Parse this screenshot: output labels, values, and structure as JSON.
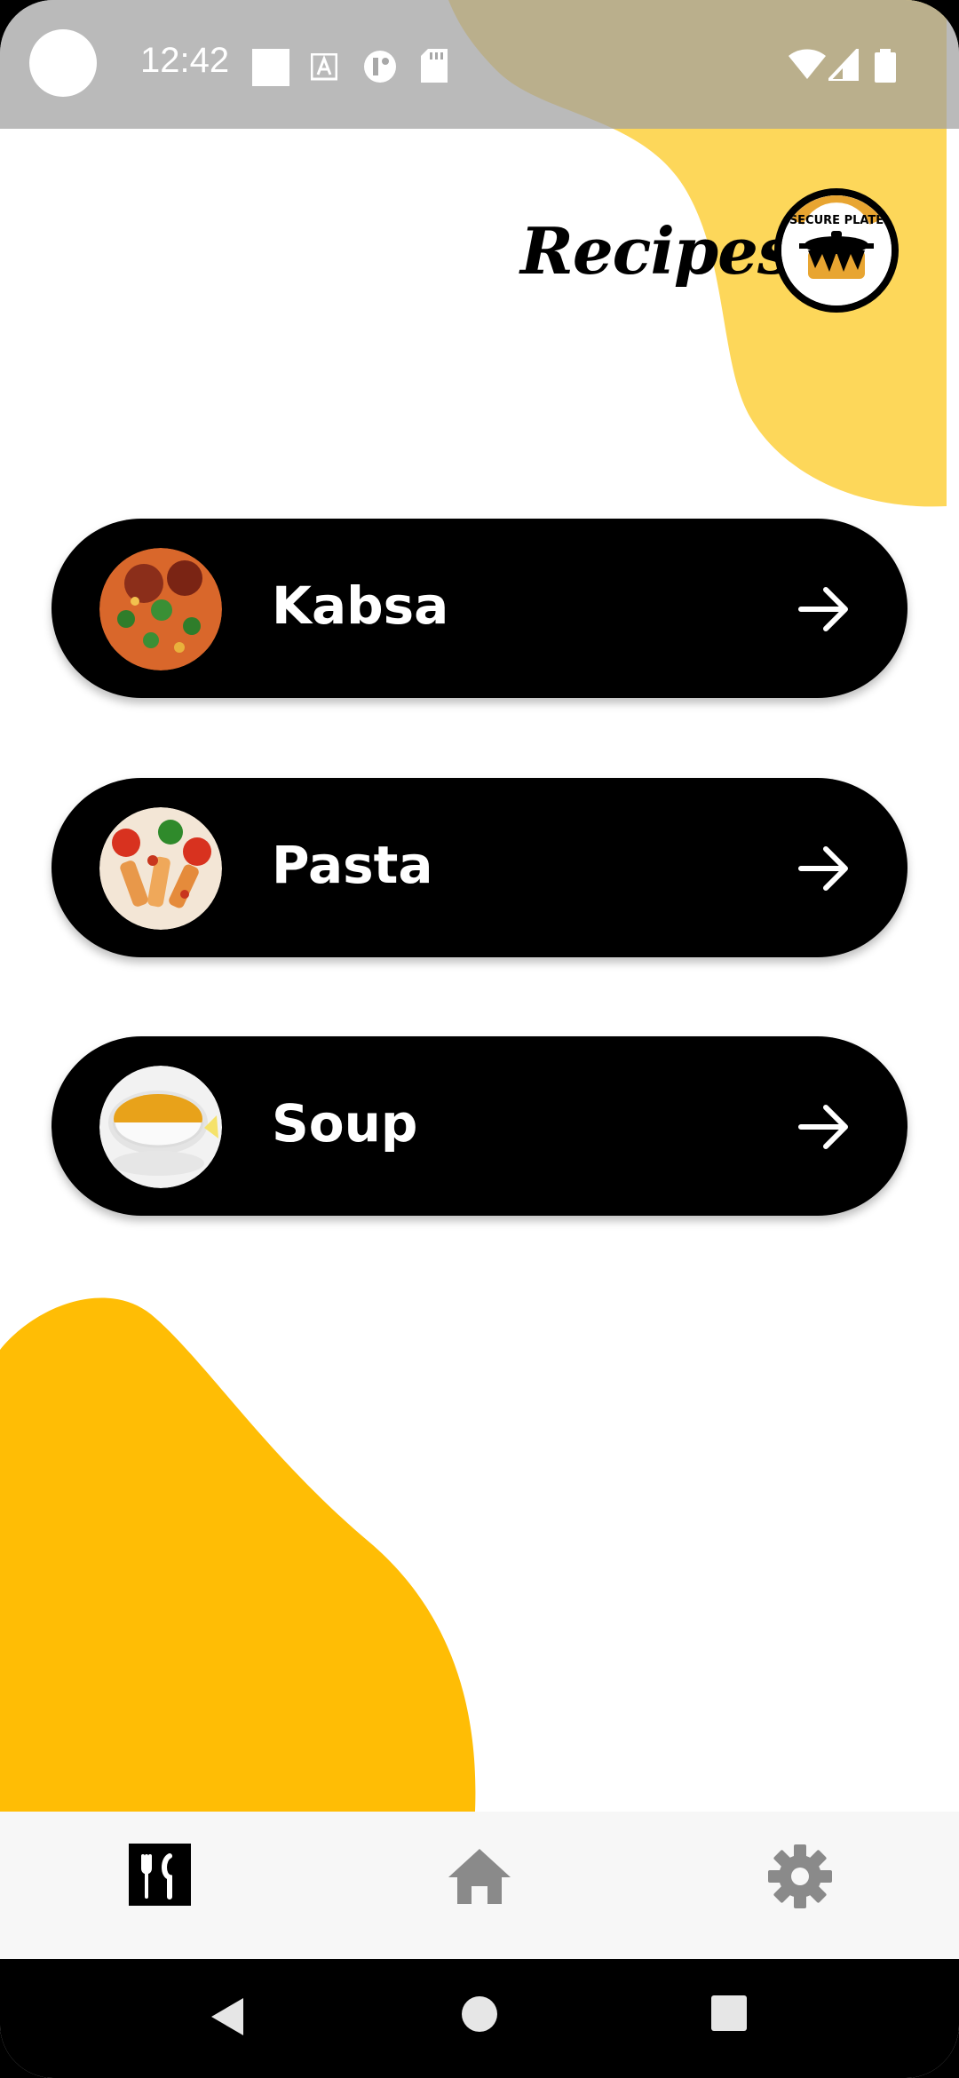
{
  "status_bar": {
    "time": "12:42"
  },
  "header": {
    "title": "Recipes",
    "logo_text": "SECURE PLATE"
  },
  "recipes": [
    {
      "label": "Kabsa",
      "thumb_icon": "kabsa-food-image",
      "arrow_icon": "arrow-right-icon"
    },
    {
      "label": "Pasta",
      "thumb_icon": "pasta-food-image",
      "arrow_icon": "arrow-right-icon"
    },
    {
      "label": "Soup",
      "thumb_icon": "soup-food-image",
      "arrow_icon": "arrow-right-icon"
    }
  ],
  "bottom_nav": {
    "items": [
      {
        "icon": "cutlery-icon",
        "active": true
      },
      {
        "icon": "home-icon",
        "active": false
      },
      {
        "icon": "gear-icon",
        "active": false
      }
    ]
  },
  "colors": {
    "accent_yellow": "#FFC107",
    "light_yellow": "#FDD75A",
    "card_bg": "#000000",
    "card_text": "#FFFFFF",
    "nav_inactive": "#8A8A8A"
  }
}
